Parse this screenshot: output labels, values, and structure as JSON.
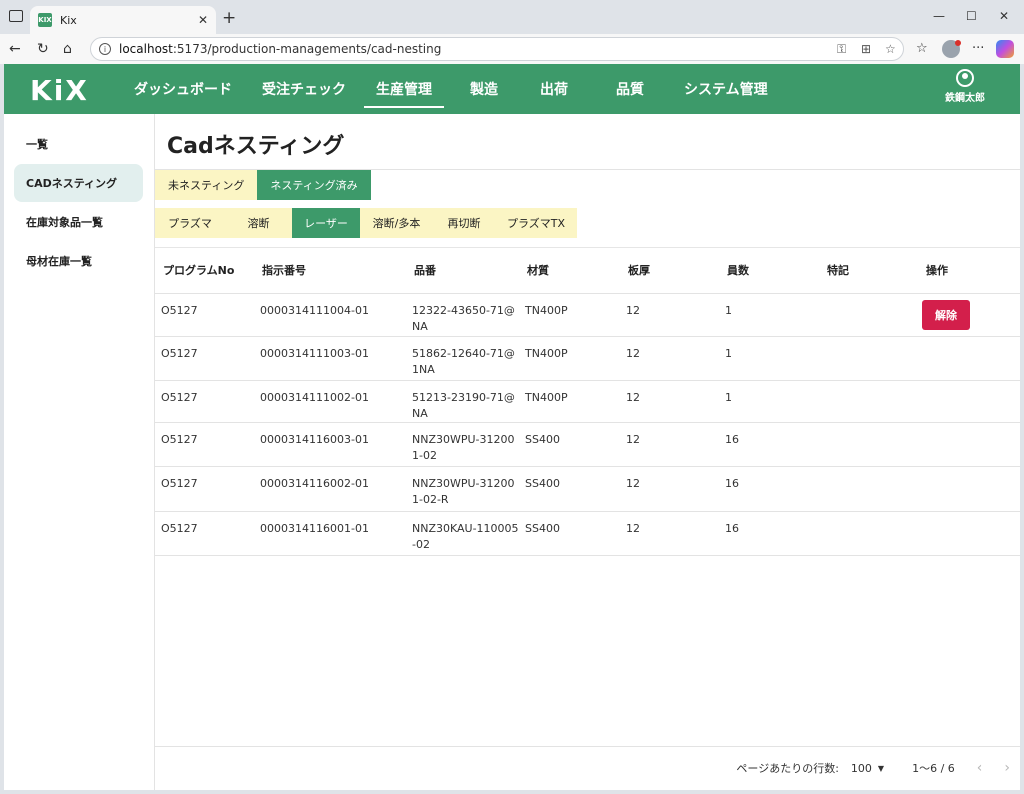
{
  "browser": {
    "tab_title": "Kix",
    "favicon_text": "KIX",
    "url_host": "localhost",
    "url_rest": ":5173/production-managements/cad-nesting"
  },
  "app": {
    "logo": "KiX",
    "nav": [
      "ダッシュボード",
      "受注チェック",
      "生産管理",
      "製造",
      "出荷",
      "品質",
      "システム管理"
    ],
    "active_nav": "生産管理",
    "user_name": "鉄鋼太郎",
    "accent_color": "#3d9a6a",
    "tab_bg_color": "#fbf5c4",
    "danger_color": "#d31f4b"
  },
  "sidebar": {
    "items": [
      "一覧",
      "CADネスティング",
      "在庫対象品一覧",
      "母材在庫一覧"
    ],
    "active": "CADネスティング"
  },
  "main": {
    "title": "Cadネスティング",
    "status_tabs": [
      "未ネスティング",
      "ネスティング済み"
    ],
    "active_status_tab": "ネスティング済み",
    "process_tabs": [
      "プラズマ",
      "溶断",
      "レーザー",
      "溶断/多本",
      "再切断",
      "プラズマTX"
    ],
    "active_process_tab": "レーザー",
    "table": {
      "columns": [
        "プログラムNo",
        "指示番号",
        "品番",
        "材質",
        "板厚",
        "員数",
        "特記",
        "操作"
      ],
      "rows": [
        [
          "O5127",
          "0000314111004-01",
          "12322-43650-71@NA",
          "TN400P",
          "12",
          "1",
          "",
          "解除"
        ],
        [
          "O5127",
          "0000314111003-01",
          "51862-12640-71@1NA",
          "TN400P",
          "12",
          "1",
          "",
          ""
        ],
        [
          "O5127",
          "0000314111002-01",
          "51213-23190-71@NA",
          "TN400P",
          "12",
          "1",
          "",
          ""
        ],
        [
          "O5127",
          "0000314116003-01",
          "NNZ30WPU-312001-02",
          "SS400",
          "12",
          "16",
          "",
          ""
        ],
        [
          "O5127",
          "0000314116002-01",
          "NNZ30WPU-312001-02-R",
          "SS400",
          "12",
          "16",
          "",
          ""
        ],
        [
          "O5127",
          "0000314116001-01",
          "NNZ30KAU-110005-02",
          "SS400",
          "12",
          "16",
          "",
          ""
        ]
      ]
    },
    "pagination": {
      "rows_per_page_label": "ページあたりの行数:",
      "rows_per_page": "100",
      "range": "1〜6 / 6"
    }
  }
}
